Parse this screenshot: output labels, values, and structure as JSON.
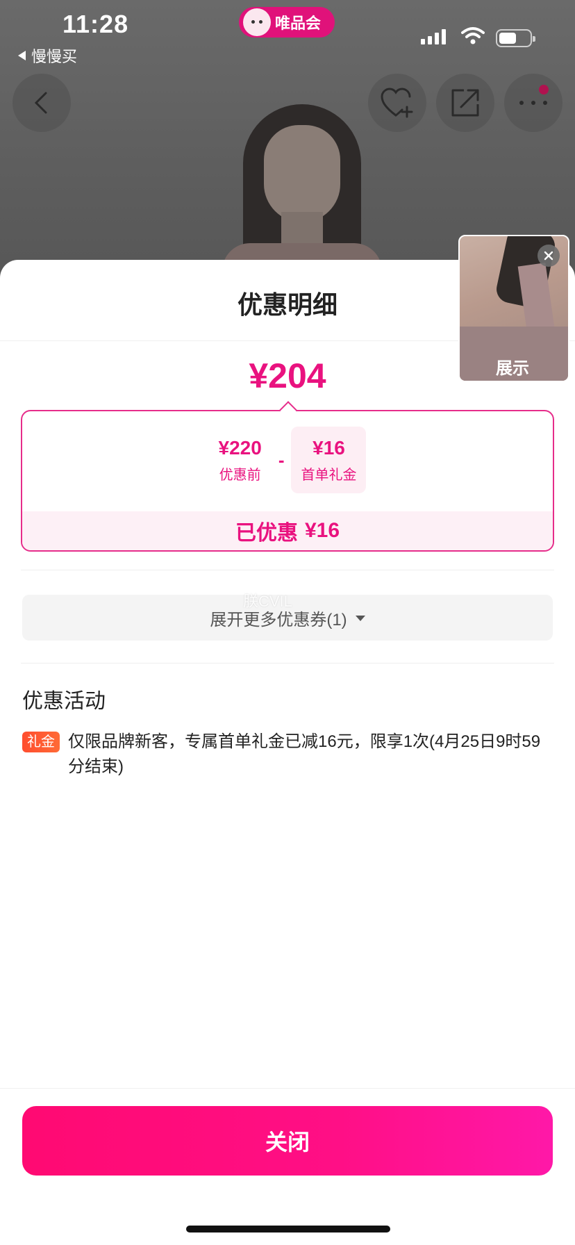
{
  "status_bar": {
    "time": "11:28",
    "back_app": "慢慢买",
    "brand": "唯品会"
  },
  "product_nav": {
    "back_icon": "chevron-left-icon",
    "favorite_icon": "heart-plus-icon",
    "share_icon": "share-icon",
    "more_icon": "more-dots-icon"
  },
  "sheet": {
    "title": "优惠明细",
    "final_price": "¥204",
    "breakdown": {
      "original_amount": "¥220",
      "original_label": "优惠前",
      "operator": "-",
      "discount_amount": "¥16",
      "discount_label": "首单礼金"
    },
    "saved_label": "已优惠",
    "saved_amount": "¥16",
    "expand_coupons": "展开更多优惠券(1)",
    "watermark": "朕CVIL",
    "promo_section_title": "优惠活动",
    "promos": [
      {
        "tag": "礼金",
        "text": "仅限品牌新客，专属首单礼金已减16元，限享1次(4月25日9时59分结束)"
      }
    ],
    "close_button": "关闭"
  },
  "floating_video": {
    "label": "展示",
    "close_icon": "close-icon"
  },
  "colors": {
    "accent": "#e9127f",
    "button_gradient_start": "#ff0a72",
    "button_gradient_end": "#ff18a8",
    "tag_orange": "#ff4d2e"
  }
}
